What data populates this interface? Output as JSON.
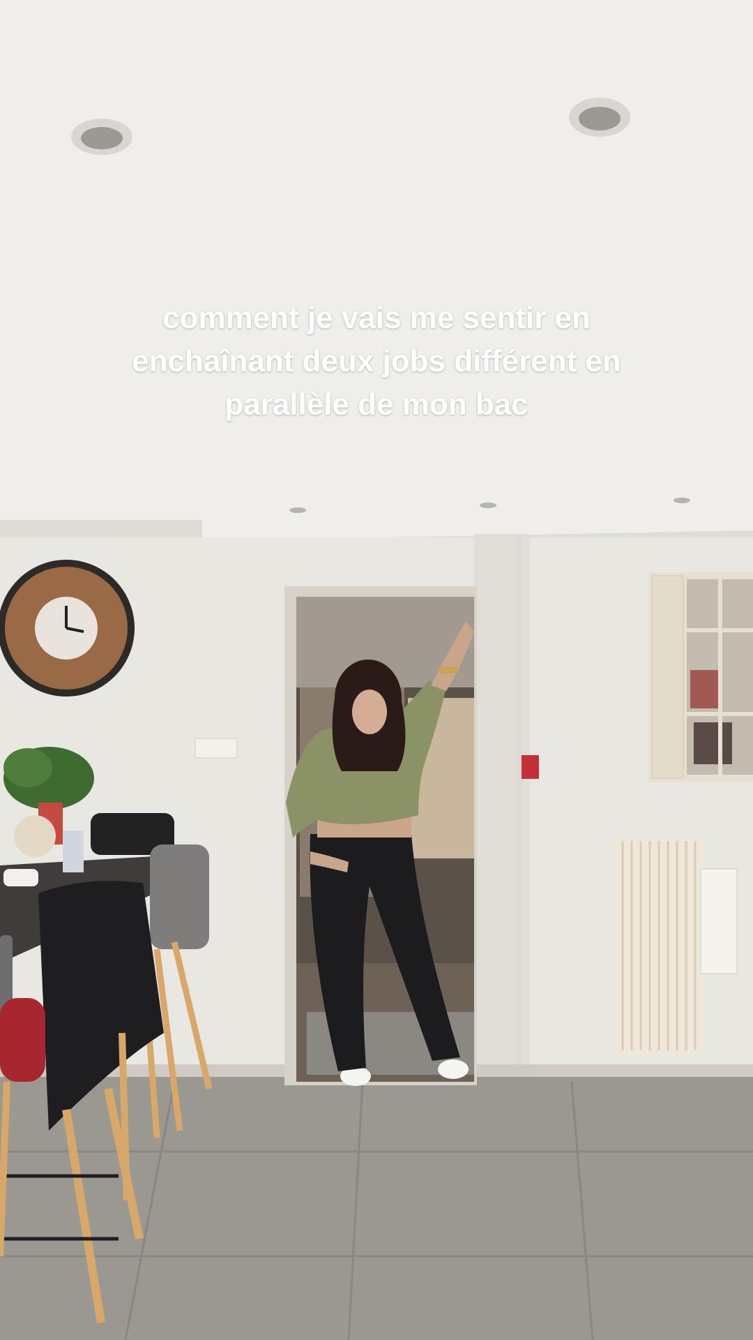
{
  "caption": {
    "text": "comment je vais me sentir en enchaînant deux jobs différent en parallèle de mon bac"
  },
  "scene": {
    "description_free": true,
    "colors": {
      "ceiling": "#efeeea",
      "wall": "#e9e7e1",
      "floor": "#9b9892",
      "doorway_dark": "#5a5149",
      "sweater": "#8b9266",
      "pants": "#1c1c1e",
      "hair": "#2b1b17",
      "table": "#3f3c3b",
      "stool_wood": "#d7a869",
      "radiator": "#efe8d8"
    }
  }
}
